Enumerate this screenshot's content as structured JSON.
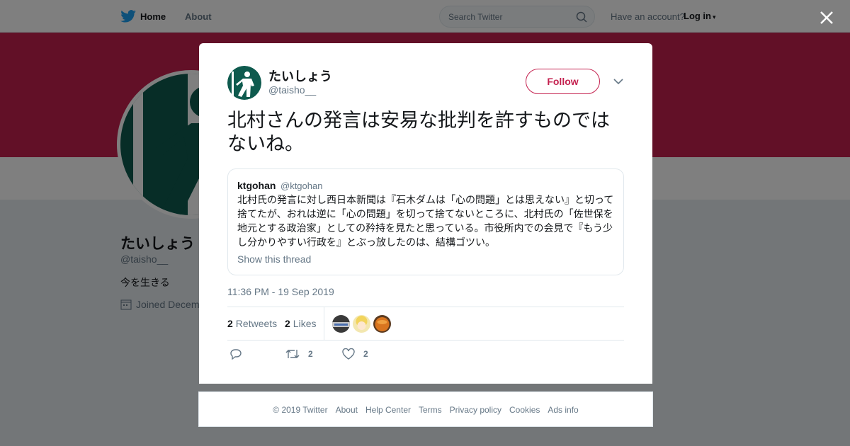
{
  "background": {
    "nav": {
      "home": "Home",
      "about": "About"
    },
    "search": {
      "placeholder": "Search Twitter"
    },
    "account": {
      "prompt": "Have an account?",
      "login": "Log in"
    },
    "profile": {
      "name": "たいしょう",
      "handle": "@taisho__",
      "bio": "今を生きる",
      "joined": "Joined Decem"
    },
    "colors": {
      "banner": "#c4214f",
      "avatar_green": "#0e5a4e"
    }
  },
  "modal": {
    "author": {
      "name": "たいしょう",
      "handle": "@taisho__"
    },
    "follow_label": "Follow",
    "text": "北村さんの発言は安易な批判を許すものではないね。",
    "quoted": {
      "name": "ktgohan",
      "handle": "@ktgohan",
      "text": "北村氏の発言に対し西日本新聞は『石木ダムは「心の問題」とは思えない』と切って捨てたが、おれは逆に「心の問題」を切って捨てないところに、北村氏の「佐世保を地元とする政治家」としての矜持を見たと思っている。市役所内での会見で『もう少し分かりやすい行政を』とぶっ放したのは、結構ゴツい。",
      "thread_link": "Show this thread"
    },
    "timestamp": "11:36 PM - 19 Sep 2019",
    "stats": {
      "retweets_count": "2",
      "retweets_label": "Retweets",
      "likes_count": "2",
      "likes_label": "Likes"
    },
    "actions": {
      "retweet_count": "2",
      "like_count": "2"
    }
  },
  "footer": {
    "links": [
      "© 2019 Twitter",
      "About",
      "Help Center",
      "Terms",
      "Privacy policy",
      "Cookies",
      "Ads info"
    ]
  }
}
